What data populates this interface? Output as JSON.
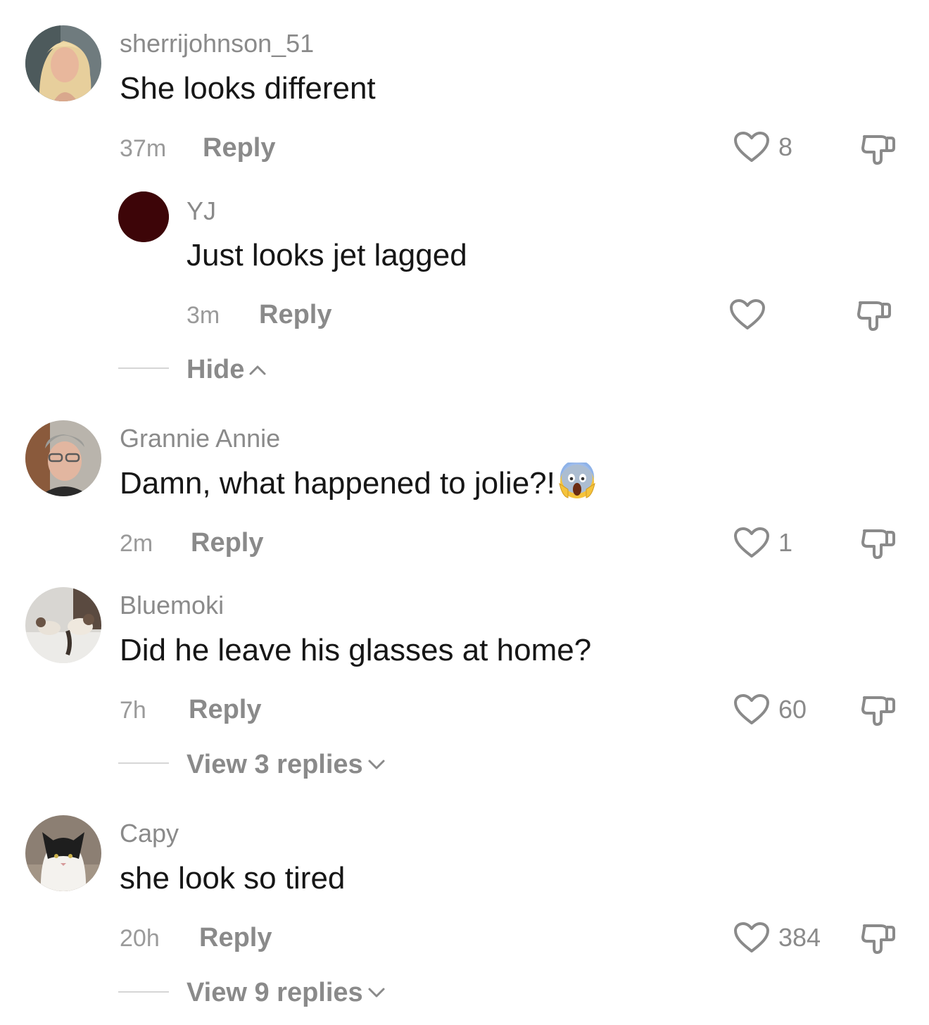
{
  "colors": {
    "username": "#8a8a8a",
    "text": "#161616",
    "meta": "#9a9a9a",
    "icon": "#8a8a8a",
    "divider": "#d6d6d6"
  },
  "comments": [
    {
      "username": "sherrijohnson_51",
      "text": "She looks different",
      "time": "37m",
      "reply_label": "Reply",
      "likes": "8",
      "avatar": "blonde-woman-avatar",
      "replies": [
        {
          "username": "YJ",
          "text": "Just looks jet lagged",
          "time": "3m",
          "reply_label": "Reply",
          "likes": "",
          "avatar": "dark-red-avatar"
        }
      ],
      "thread_toggle": {
        "label": "Hide",
        "icon": "chevron-up-icon"
      }
    },
    {
      "username": "Grannie Annie",
      "text": "Damn, what happened to jolie?!",
      "emoji": "screaming-face-emoji",
      "time": "2m",
      "reply_label": "Reply",
      "likes": "1",
      "avatar": "woman-glasses-avatar"
    },
    {
      "username": "Bluemoki",
      "text": "Did he leave his glasses at home?",
      "time": "7h",
      "reply_label": "Reply",
      "likes": "60",
      "avatar": "cats-avatar",
      "thread_toggle": {
        "label": "View 3 replies",
        "icon": "chevron-down-icon"
      }
    },
    {
      "username": "Capy",
      "text": "she look so tired",
      "time": "20h",
      "reply_label": "Reply",
      "likes": "384",
      "avatar": "black-white-cat-avatar",
      "thread_toggle": {
        "label": "View 9 replies",
        "icon": "chevron-down-icon"
      }
    }
  ]
}
